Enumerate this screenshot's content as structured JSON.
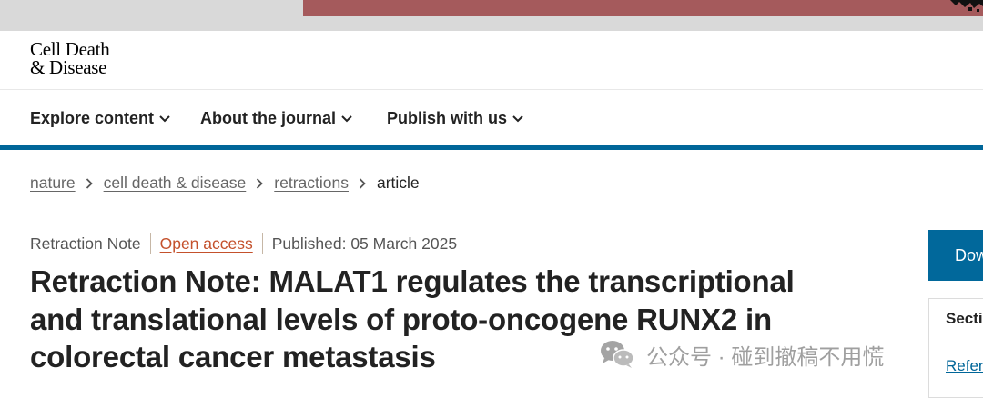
{
  "ad": {
    "banner_color": "#a55a5c",
    "strip_color": "#d9d9d9"
  },
  "journal": {
    "logo_line1": "Cell Death",
    "logo_line2": "& Disease"
  },
  "nav": {
    "items": [
      {
        "label": "Explore content",
        "icon": "chevron-down-icon"
      },
      {
        "label": "About the journal",
        "icon": "chevron-down-icon"
      },
      {
        "label": "Publish with us",
        "icon": "chevron-down-icon"
      }
    ],
    "accent_color": "#006699"
  },
  "breadcrumb": {
    "items": [
      "nature",
      "cell death & disease",
      "retractions"
    ],
    "current": "article"
  },
  "article": {
    "type": "Retraction Note",
    "access": "Open access",
    "published": "Published: 05 March 2025",
    "title": "Retraction Note: MALAT1 regulates the transcriptional and translational levels of proto-oncogene RUNX2 in colorectal cancer metastasis"
  },
  "sidebar": {
    "download_label": "Dow",
    "sections_label": "Secti",
    "references_link": "Refer"
  },
  "watermark": {
    "text": "公众号 · 碰到撤稿不用慌",
    "icon": "wechat-icon"
  }
}
